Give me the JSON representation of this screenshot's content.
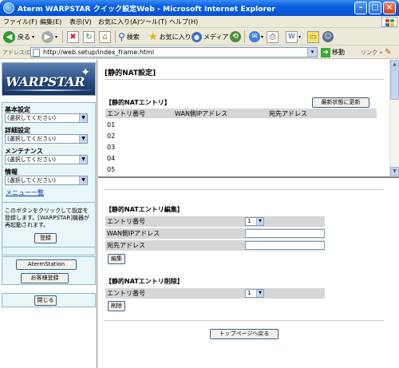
{
  "window": {
    "title": "Aterm WARPSTAR クイック設定Web - Microsoft Internet Explorer"
  },
  "menubar": {
    "items": [
      "ファイル(F)",
      "編集(E)",
      "表示(V)",
      "お気に入り(A)",
      "ツール(T)",
      "ヘルプ(H)"
    ]
  },
  "toolbar": {
    "back_label": "戻る",
    "search_label": "検索",
    "favorites_label": "お気に入り",
    "media_label": "メディア"
  },
  "addressbar": {
    "label": "アドレス(D)",
    "url": "http://web.setup/index_frame.html",
    "go_label": "移動",
    "links_label": "リンク"
  },
  "sidebar": {
    "logo_text": "WARPSTAR",
    "groups": [
      {
        "label": "基本設定",
        "select_value": "(選択してください)"
      },
      {
        "label": "詳細設定",
        "select_value": "(選択してください)"
      },
      {
        "label": "メンテナンス",
        "select_value": "(選択してください)"
      },
      {
        "label": "情報",
        "select_value": "(選択してください)"
      }
    ],
    "menu_list_link": "メニュー一覧",
    "register_hint": "このボタンをクリックして設定を登録します。[WARPSTAR]機器が再起動されます。",
    "register_button": "登録",
    "aterm_station_button": "AtermStation",
    "customer_register_button": "お客様登録",
    "close_button": "閉じる"
  },
  "top_frame": {
    "page_title": "[静的NAT設定]",
    "section_title": "【静的NATエントリ】",
    "refresh_button": "最新状態に更新",
    "columns": [
      "エントリ番号",
      "WAN側IPアドレス",
      "宛先アドレス"
    ],
    "rows": [
      "01",
      "02",
      "03",
      "04",
      "05"
    ]
  },
  "bottom_frame": {
    "edit_section_title": "【静的NATエントリ編集】",
    "edit_fields": {
      "entry_label": "エントリ番号",
      "entry_value": "1",
      "wan_ip_label": "WAN側IPアドレス",
      "wan_ip_value": "",
      "dest_label": "宛先アドレス",
      "dest_value": ""
    },
    "edit_button": "編集",
    "delete_section_title": "【静的NATエントリ削除】",
    "delete_entry_label": "エントリ番号",
    "delete_entry_value": "1",
    "delete_button": "削除",
    "top_page_button": "トップページへ戻る"
  },
  "colors": {
    "titlebar": "#0a5fe0",
    "sidebar_panel": "#e9f6f8",
    "sidebar_border": "#86b9c6",
    "table_header": "#d6d6d6",
    "link": "#0033cc"
  }
}
